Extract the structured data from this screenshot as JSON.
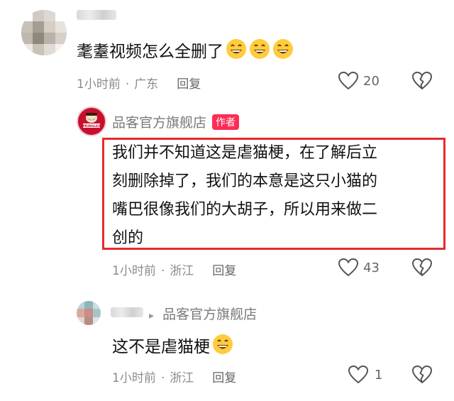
{
  "comments": [
    {
      "text": "耄耋视频怎么全删了",
      "emoji_count": 3,
      "time": "1小时前",
      "separator": "·",
      "location": "广东",
      "reply_label": "回复",
      "likes": "20"
    }
  ],
  "brand_reply": {
    "username": "品客官方旗舰店",
    "badge": "作者",
    "avatar_text": "PRINGLES",
    "lines": [
      "我们并不知道这是虐猫梗，在了解后立",
      "刻删除掉了，我们的本意是这只小猫的",
      "嘴巴很像我们的大胡子，所以用来做二",
      "创的"
    ],
    "time": "1小时前",
    "separator": "·",
    "location": "浙江",
    "reply_label": "回复",
    "likes": "43"
  },
  "nested_reply": {
    "reply_to_arrow": "▸",
    "reply_to": "品客官方旗舰店",
    "text": "这不是虐猫梗",
    "emoji_count": 1,
    "time": "1小时前",
    "separator": "·",
    "location": "浙江",
    "reply_label": "回复",
    "likes": "1"
  },
  "colors": {
    "accent_red": "#e52c2c",
    "badge_pink": "#fe2c55",
    "brand_red": "#c8102e",
    "meta_gray": "#8a8a8a"
  },
  "icons": [
    "heart-outline-icon",
    "broken-heart-icon",
    "grinning-face-emoji"
  ]
}
